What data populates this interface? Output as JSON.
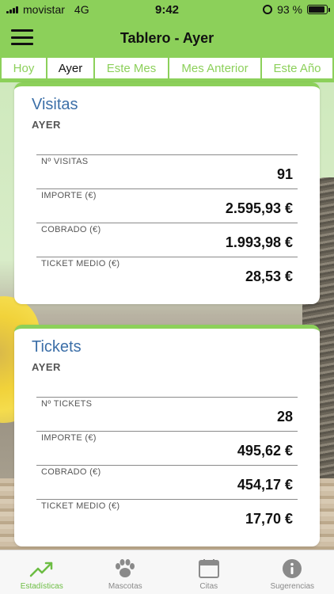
{
  "status": {
    "carrier": "movistar",
    "network": "4G",
    "time": "9:42",
    "battery": "93 %",
    "battery_level": 0.93
  },
  "nav": {
    "title": "Tablero - Ayer",
    "menu_icon": "hamburger-icon"
  },
  "tabs": [
    {
      "label": "Hoy"
    },
    {
      "label": "Ayer"
    },
    {
      "label": "Este Mes"
    },
    {
      "label": "Mes Anterior"
    },
    {
      "label": "Este Año"
    }
  ],
  "selected_tab": "Ayer",
  "visitas": {
    "title": "Visitas",
    "subtitle": "AYER",
    "metrics": [
      {
        "label": "Nº VISITAS",
        "value": "91"
      },
      {
        "label": "IMPORTE (€)",
        "value": "2.595,93 €"
      },
      {
        "label": "COBRADO (€)",
        "value": "1.993,98 €"
      },
      {
        "label": "TICKET MEDIO (€)",
        "value": "28,53 €"
      }
    ]
  },
  "tickets": {
    "title": "Tickets",
    "subtitle": "AYER",
    "metrics": [
      {
        "label": "Nº TICKETS",
        "value": "28"
      },
      {
        "label": "IMPORTE (€)",
        "value": "495,62 €"
      },
      {
        "label": "COBRADO (€)",
        "value": "454,17 €"
      },
      {
        "label": "TICKET MEDIO (€)",
        "value": "17,70 €"
      }
    ]
  },
  "tabbar": {
    "items": [
      {
        "label": "Estadísticas",
        "icon": "trending-up-icon",
        "active": true
      },
      {
        "label": "Mascotas",
        "icon": "paw-icon",
        "active": false
      },
      {
        "label": "Citas",
        "icon": "calendar-icon",
        "active": false
      },
      {
        "label": "Sugerencias",
        "icon": "info-icon",
        "active": false
      }
    ]
  },
  "colors": {
    "accent": "#8cd05a",
    "title_blue": "#3c6fa8",
    "tab_active": "#6cbd43",
    "tab_inactive": "#8a8a8a"
  }
}
